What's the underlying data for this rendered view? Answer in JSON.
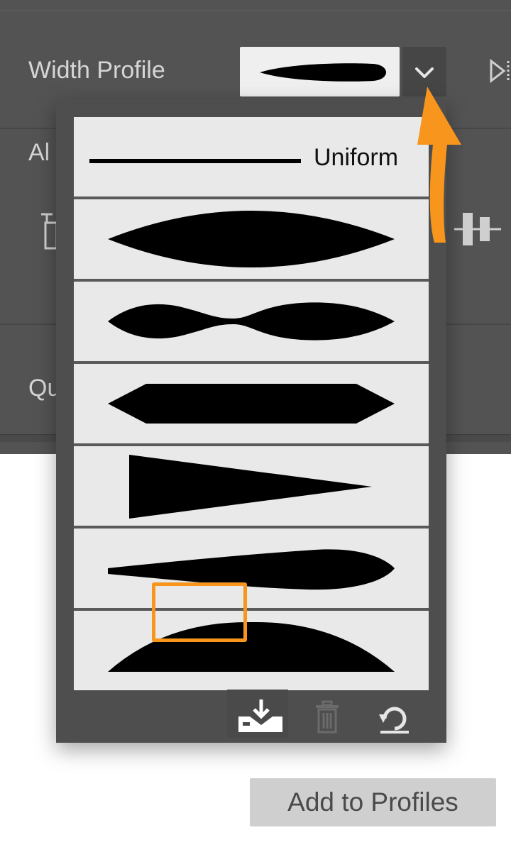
{
  "panel": {
    "width_profile_label": "Width Profile",
    "partial_label_1": "Al",
    "partial_label_2": "Qu"
  },
  "dropdown": {
    "profiles": [
      {
        "label": "Uniform",
        "shape": "uniform"
      },
      {
        "shape": "lens"
      },
      {
        "shape": "double-lens"
      },
      {
        "shape": "hexagon"
      },
      {
        "shape": "taper-right"
      },
      {
        "shape": "asymmetric-lens"
      },
      {
        "shape": "half-round"
      }
    ],
    "actions": [
      {
        "name": "add-to-profiles",
        "icon": "save-download-icon"
      },
      {
        "name": "delete-profile",
        "icon": "trash-icon"
      },
      {
        "name": "reset-profiles",
        "icon": "reset-icon"
      }
    ]
  },
  "tooltip": {
    "text": "Add to Profiles"
  },
  "colors": {
    "panel_bg": "#535353",
    "dropdown_bg": "#4e4e4e",
    "item_bg": "#e9e9e9",
    "accent_orange": "#f7951d",
    "tooltip_bg": "#cfcfcf"
  }
}
